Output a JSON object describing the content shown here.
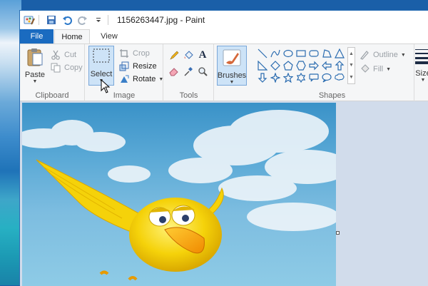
{
  "window": {
    "title": "1156263447.jpg - Paint"
  },
  "tabs": {
    "file": "File",
    "home": "Home",
    "view": "View"
  },
  "clipboard": {
    "paste": "Paste",
    "cut": "Cut",
    "copy": "Copy",
    "label": "Clipboard"
  },
  "image": {
    "select": "Select",
    "crop": "Crop",
    "resize": "Resize",
    "rotate": "Rotate",
    "label": "Image"
  },
  "tools": {
    "label": "Tools"
  },
  "brushes": {
    "label": "Brushes"
  },
  "shapes": {
    "outline": "Outline",
    "fill": "Fill",
    "label": "Shapes"
  },
  "size": {
    "label": "Size"
  },
  "colors": {
    "accent": "#1a6bc0",
    "selected_bg": "#cde3f7",
    "shape_stroke": "#2b6cb0"
  },
  "icons": [
    "paint-app-icon",
    "save-icon",
    "undo-icon",
    "redo-icon",
    "customize-arrow-icon",
    "paste-icon",
    "scissors-icon",
    "copy-icon",
    "select-rect-icon",
    "crop-icon",
    "resize-icon",
    "rotate-icon",
    "pencil-icon",
    "fill-bucket-icon",
    "text-icon",
    "eraser-icon",
    "color-picker-icon",
    "magnifier-icon",
    "brush-icon",
    "outline-icon",
    "fill-icon",
    "size-lines-icon",
    "mouse-cursor-icon"
  ]
}
